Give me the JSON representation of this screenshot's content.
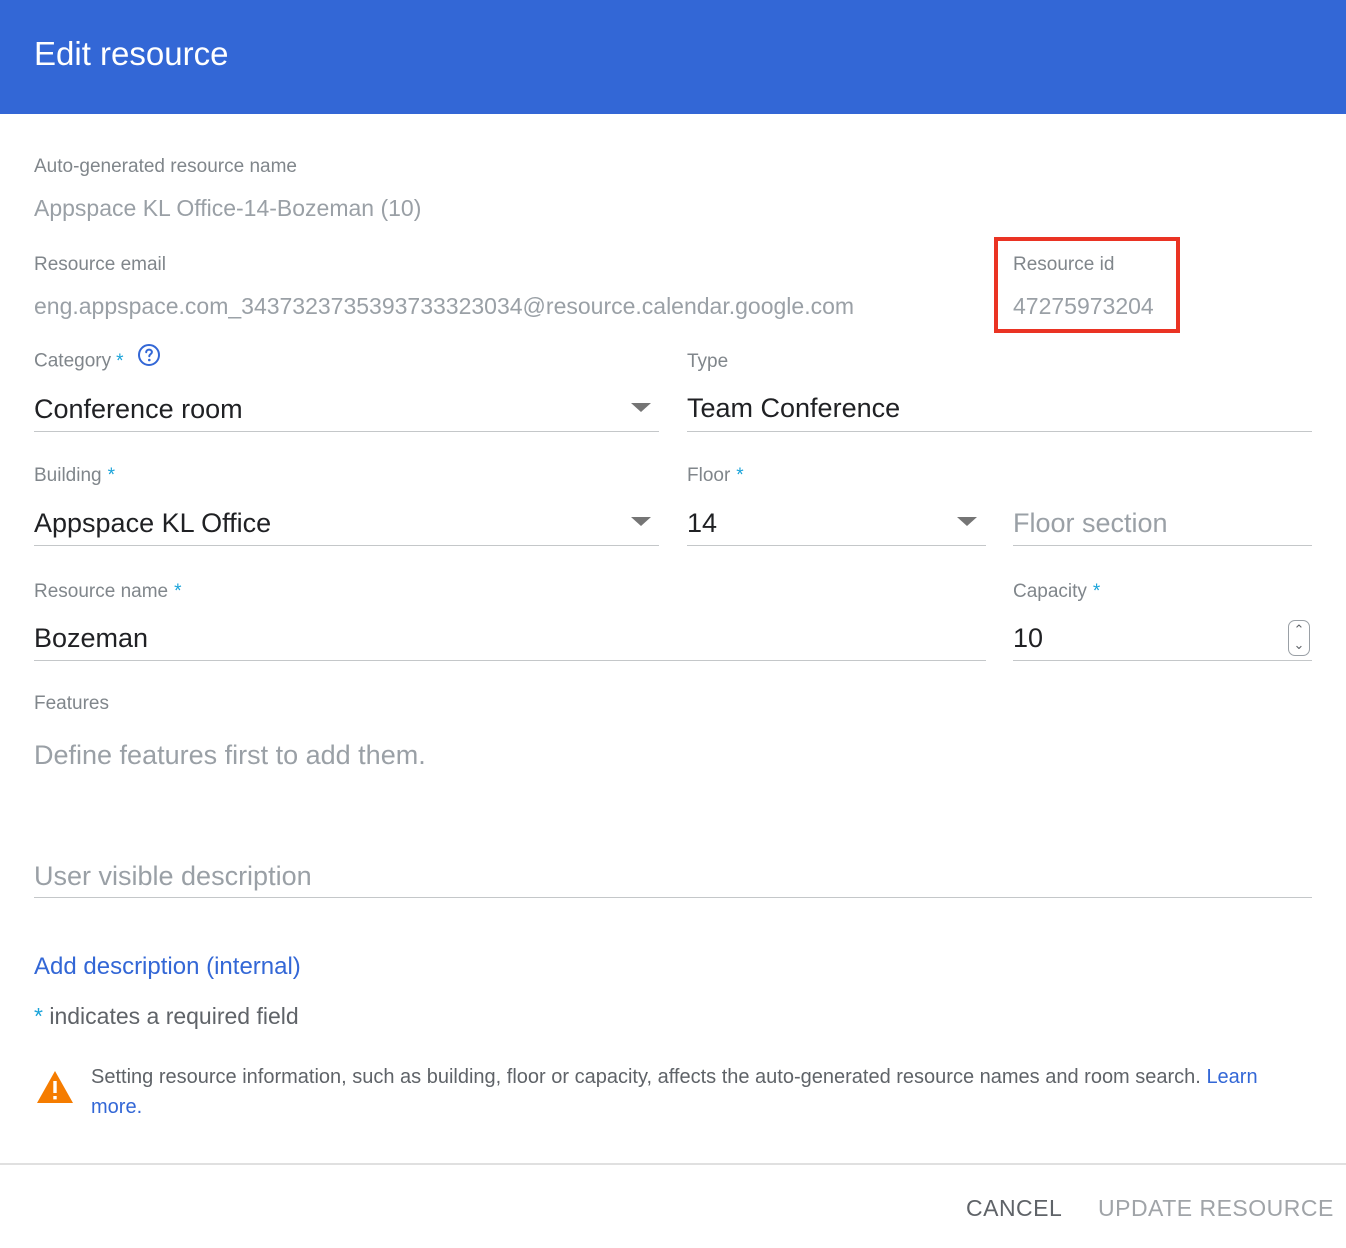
{
  "dialog": {
    "title": "Edit resource"
  },
  "auto_name": {
    "label": "Auto-generated resource name",
    "value": "Appspace KL Office-14-Bozeman (10)"
  },
  "resource_email": {
    "label": "Resource email",
    "value": "eng.appspace.com_3437323735393733323034@resource.calendar.google.com"
  },
  "resource_id": {
    "label": "Resource id",
    "value": "47275973204"
  },
  "category": {
    "label": "Category",
    "required_mark": "*",
    "value": "Conference room",
    "help_icon": "help-circle-icon",
    "arrow_icon": "dropdown-arrow-icon"
  },
  "type": {
    "label": "Type",
    "value": "Team Conference"
  },
  "building": {
    "label": "Building",
    "required_mark": "*",
    "value": "Appspace KL Office",
    "arrow_icon": "dropdown-arrow-icon"
  },
  "floor": {
    "label": "Floor",
    "required_mark": "*",
    "value": "14",
    "arrow_icon": "dropdown-arrow-icon"
  },
  "floor_section": {
    "placeholder": "Floor section"
  },
  "resource_name": {
    "label": "Resource name",
    "required_mark": "*",
    "value": "Bozeman"
  },
  "capacity": {
    "label": "Capacity",
    "required_mark": "*",
    "value": "10",
    "stepper_icon": "number-stepper-icon"
  },
  "features": {
    "label": "Features",
    "empty_text": "Define features first to add them."
  },
  "user_description": {
    "placeholder": "User visible description"
  },
  "add_description_link": "Add description (internal)",
  "required_note": {
    "mark": "*",
    "text": "indicates a required field"
  },
  "warning": {
    "icon": "warning-triangle-icon",
    "text": "Setting resource information, such as building, floor or capacity, affects the auto-generated resource names and room search.",
    "link": "Learn more."
  },
  "actions": {
    "cancel": "CANCEL",
    "update": "UPDATE RESOURCE"
  },
  "colors": {
    "header": "#3367d6",
    "link": "#3367d6",
    "required": "#1aa3d9",
    "highlight": "#ea3323",
    "warning": "#f57c00"
  }
}
